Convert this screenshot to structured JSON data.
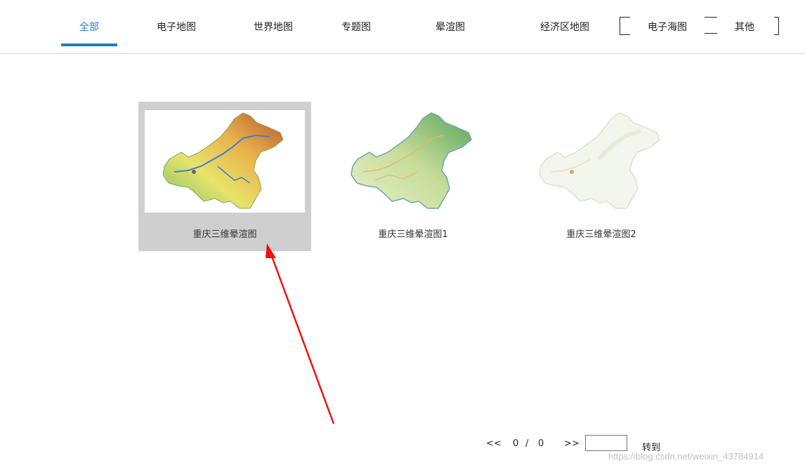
{
  "tabs": [
    {
      "label": "全部",
      "active": true
    },
    {
      "label": "电子地图"
    },
    {
      "label": "世界地图"
    },
    {
      "label": "专题图"
    },
    {
      "label": "晕渲图"
    },
    {
      "label": "经济区地图"
    },
    {
      "label": "电子海图"
    },
    {
      "label": "其他"
    }
  ],
  "cards": [
    {
      "caption": "重庆三维晕渲图",
      "selected": true
    },
    {
      "caption": "重庆三维晕渲图1"
    },
    {
      "caption": "重庆三维晕渲图2"
    }
  ],
  "pager": {
    "prev": "<<",
    "current": "0",
    "separator": "/",
    "total": "0",
    "next": ">>",
    "goto_label": "转到",
    "input_value": ""
  },
  "watermark": "https://blog.csdn.net/weixin_43784914",
  "colors": {
    "accent": "#1f7ccc",
    "arrow": "#ee1111",
    "selected_bg": "#cfcfcf"
  }
}
